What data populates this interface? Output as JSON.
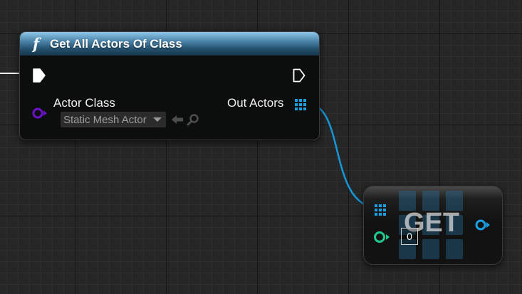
{
  "function_node": {
    "title": "Get All Actors Of Class",
    "icon": "function-icon",
    "icon_glyph": "f",
    "inputs": {
      "actor_class_label": "Actor Class",
      "actor_class_value": "Static Mesh Actor"
    },
    "outputs": {
      "out_actors_label": "Out Actors"
    }
  },
  "get_node": {
    "title": "GET",
    "index_value": "0"
  },
  "colors": {
    "canvas_background": "#262626",
    "function_header": "#4c86ab",
    "exec_pin": "#ffffff",
    "class_pin": "#6a13c9",
    "object_array_pin": "#1aa1e4",
    "integer_pin": "#1ec98c",
    "object_out_pin": "#1aa1e4"
  }
}
